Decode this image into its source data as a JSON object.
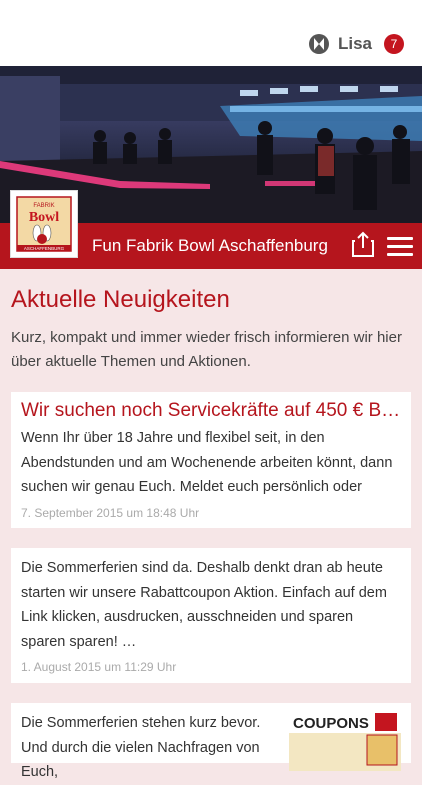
{
  "header": {
    "user_name": "Lisa",
    "notification_count": "7",
    "logo_icon": "app-logo-icon"
  },
  "venue": {
    "name": "Fun Fabrik Bowl Aschaffenburg",
    "logo_text_top": "FABRIK",
    "logo_text_mid": "Bowl",
    "logo_text_bottom": "ASCHAFFENBURG",
    "share_icon": "share-icon",
    "menu_icon": "hamburger-menu-icon"
  },
  "news": {
    "heading": "Aktuelle Neuigkeiten",
    "intro": "Kurz, kompakt und immer wieder frisch informieren wir hier über aktuelle Themen und Aktionen.",
    "items": [
      {
        "title": "Wir suchen noch Servicekräfte auf 450 € Ba…",
        "body": "Wenn Ihr über 18 Jahre und flexibel seit, in den Abendstunden und am Wochenende arbeiten könnt, dann suchen wir genau Euch. Meldet euch persönlich oder",
        "date": "7. September 2015 um 18:48 Uhr"
      },
      {
        "title": "",
        "body": "Die Sommerferien sind da. Deshalb denkt dran ab heute starten wir unsere Rabattcoupon Aktion. Einfach auf dem Link klicken, ausdrucken, ausschneiden und sparen sparen sparen! …",
        "date": "1. August 2015 um 11:29 Uhr"
      },
      {
        "title": "",
        "body": "Die Sommerferien stehen kurz bevor. Und durch die vielen Nachfragen von Euch,",
        "date": "",
        "image_text": "COUPONS"
      }
    ]
  },
  "colors": {
    "brand_red": "#b5151d",
    "background": "#f6e6e7",
    "badge_red": "#c4151f"
  }
}
